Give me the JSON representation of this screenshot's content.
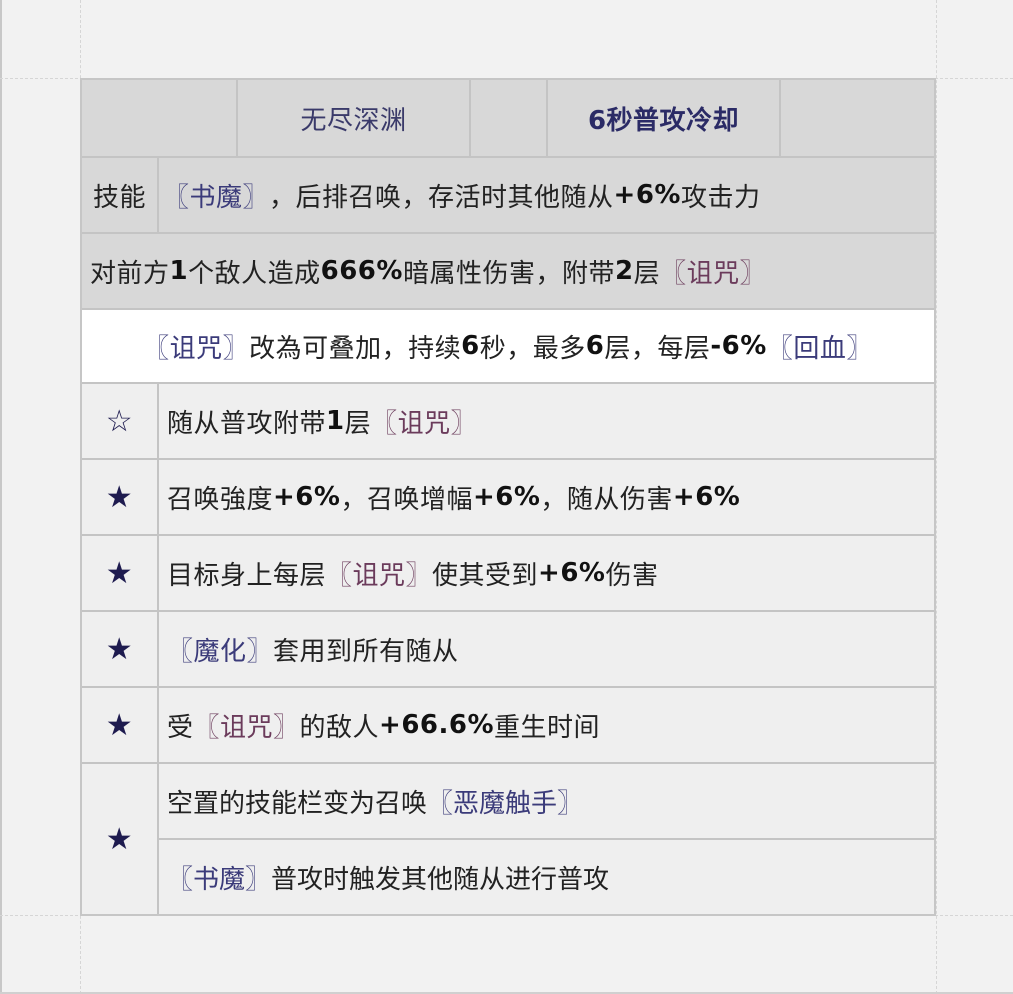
{
  "header": {
    "blank_left": "",
    "title": "无尽深渊",
    "blank_mid": "",
    "cooldown": "6秒普攻冷却",
    "blank_right": ""
  },
  "skill": {
    "label": "技能",
    "link": "〖书魔〗",
    "text_a": "，后排召唤，存活时其他随从",
    "bold": "+6%",
    "text_b": "攻击力"
  },
  "attack": {
    "text_a": "对前方",
    "bold_a": "1",
    "text_b": "个敌人造成",
    "bold_b": "666%",
    "text_c": "暗属性伤害，附带",
    "bold_c": "2",
    "text_d": "层",
    "curse": "〖诅咒〗"
  },
  "passive": {
    "curse": "〖诅咒〗",
    "text_a": "改為可叠加，持续",
    "bold_a": "6",
    "text_b": "秒，最多",
    "bold_b": "6",
    "text_c": "层，每层",
    "bold_c": "-6%",
    "heal": "〖回血〗"
  },
  "upgrades": [
    {
      "star": "☆",
      "text_a": "随从普攻附带",
      "bold_a": "1",
      "text_b": "层",
      "curse": "〖诅咒〗"
    },
    {
      "star": "★",
      "text_a": "召唤強度",
      "bold_a": "+6%",
      "text_b": "，召唤增幅",
      "bold_b": "+6%",
      "text_c": "，随从伤害",
      "bold_c": "+6%"
    },
    {
      "star": "★",
      "text_a": "目标身上每层",
      "curse": "〖诅咒〗",
      "text_b": "使其受到",
      "bold_a": "+6%",
      "text_c": "伤害"
    },
    {
      "star": "★",
      "link": "〖魔化〗",
      "text_a": "套用到所有随从"
    },
    {
      "star": "★",
      "text_a": "受",
      "curse": "〖诅咒〗",
      "text_b": "的敌人",
      "bold_a": "+66.6%",
      "text_c": "重生时间"
    },
    {
      "star": "★",
      "line1_text": "空置的技能栏变为召唤",
      "line1_link": "〖恶魔触手〗",
      "line2_link": "〖书魔〗",
      "line2_text": "普攻时触发其他随从进行普攻"
    }
  ]
}
